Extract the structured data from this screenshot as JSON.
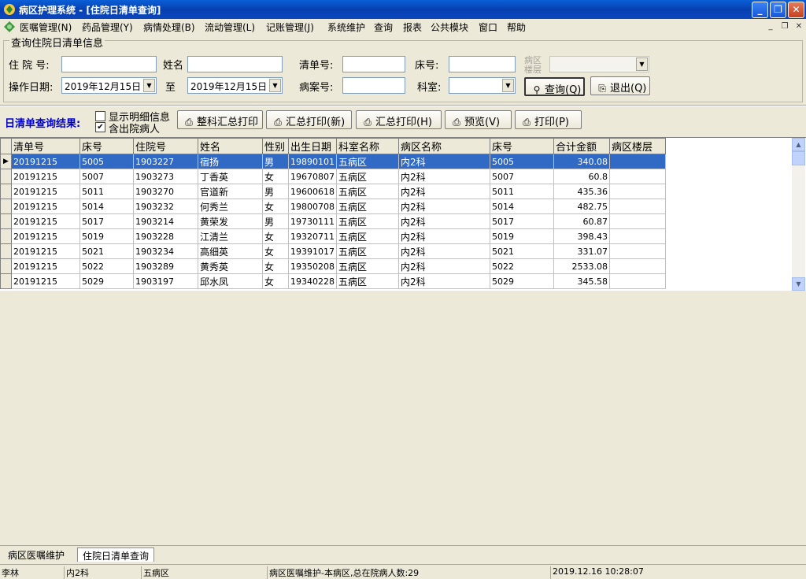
{
  "window": {
    "title": "病区护理系统 - [住院日清单查询]",
    "minimize": "_",
    "maximize": "❐",
    "close": "✕"
  },
  "menu": {
    "items": [
      "医嘱管理(N)",
      "药品管理(Y)",
      "病情处理(B)",
      "流动管理(L)",
      "记账管理(J)",
      "系统维护",
      "查询",
      "报表",
      "公共模块",
      "窗口",
      "帮助"
    ],
    "mdi_minimize": "_",
    "mdi_restore": "❐",
    "mdi_close": "✕"
  },
  "query": {
    "group_title": "查询住院日清单信息",
    "admission_no_label": "住 院 号:",
    "admission_no_value": "",
    "name_label": "姓名",
    "name_value": "",
    "bill_no_label": "清单号:",
    "bill_no_value": "",
    "bed_no_label": "床号:",
    "bed_no_value": "",
    "ward_floor_label_1": "病区",
    "ward_floor_label_2": "楼层",
    "ward_floor_value": "",
    "op_date_label": "操作日期:",
    "date_from": "2019年12月15日",
    "to_label": "至",
    "date_to": "2019年12月15日",
    "case_no_label": "病案号:",
    "case_no_value": "",
    "dept_label": "科室:",
    "dept_value": "",
    "search_button": "查询(Q)",
    "exit_button": "退出(Q)"
  },
  "results_toolbar": {
    "title": "日清单查询结果:",
    "show_detail_label": "显示明细信息",
    "show_detail_checked": false,
    "include_discharged_label": "含出院病人",
    "include_discharged_checked": true,
    "buttons": [
      "整科汇总打印",
      "汇总打印(新)",
      "汇总打印(H)",
      "预览(V)",
      "打印(P)"
    ]
  },
  "grid": {
    "columns": [
      "清单号",
      "床号",
      "住院号",
      "姓名",
      "性别",
      "出生日期",
      "科室名称",
      "病区名称",
      "床号",
      "合计金额",
      "病区楼层"
    ],
    "rows": [
      [
        "20191215",
        "5005",
        "1903227",
        "宿扬",
        "男",
        "19890101",
        "五病区",
        "内2科",
        "5005",
        "340.08",
        ""
      ],
      [
        "20191215",
        "5007",
        "1903273",
        "丁香英",
        "女",
        "19670807",
        "五病区",
        "内2科",
        "5007",
        "60.8",
        ""
      ],
      [
        "20191215",
        "5011",
        "1903270",
        "官道新",
        "男",
        "19600618",
        "五病区",
        "内2科",
        "5011",
        "435.36",
        ""
      ],
      [
        "20191215",
        "5014",
        "1903232",
        "何秀兰",
        "女",
        "19800708",
        "五病区",
        "内2科",
        "5014",
        "482.75",
        ""
      ],
      [
        "20191215",
        "5017",
        "1903214",
        "黄荣发",
        "男",
        "19730111",
        "五病区",
        "内2科",
        "5017",
        "60.87",
        ""
      ],
      [
        "20191215",
        "5019",
        "1903228",
        "江清兰",
        "女",
        "19320711",
        "五病区",
        "内2科",
        "5019",
        "398.43",
        ""
      ],
      [
        "20191215",
        "5021",
        "1903234",
        "高细英",
        "女",
        "19391017",
        "五病区",
        "内2科",
        "5021",
        "331.07",
        ""
      ],
      [
        "20191215",
        "5022",
        "1903289",
        "黄秀英",
        "女",
        "19350208",
        "五病区",
        "内2科",
        "5022",
        "2533.08",
        ""
      ],
      [
        "20191215",
        "5029",
        "1903197",
        "邱水凤",
        "女",
        "19340228",
        "五病区",
        "内2科",
        "5029",
        "345.58",
        ""
      ]
    ],
    "selected_row": 0
  },
  "tabs": [
    "病区医嘱维护",
    "住院日清单查询"
  ],
  "active_tab": 1,
  "status": {
    "user": "李林",
    "dept": "内2科",
    "ward": "五病区",
    "message": "病区医嘱维护-本病区,总在院病人数:29",
    "datetime": "2019.12.16 10:28:07"
  }
}
